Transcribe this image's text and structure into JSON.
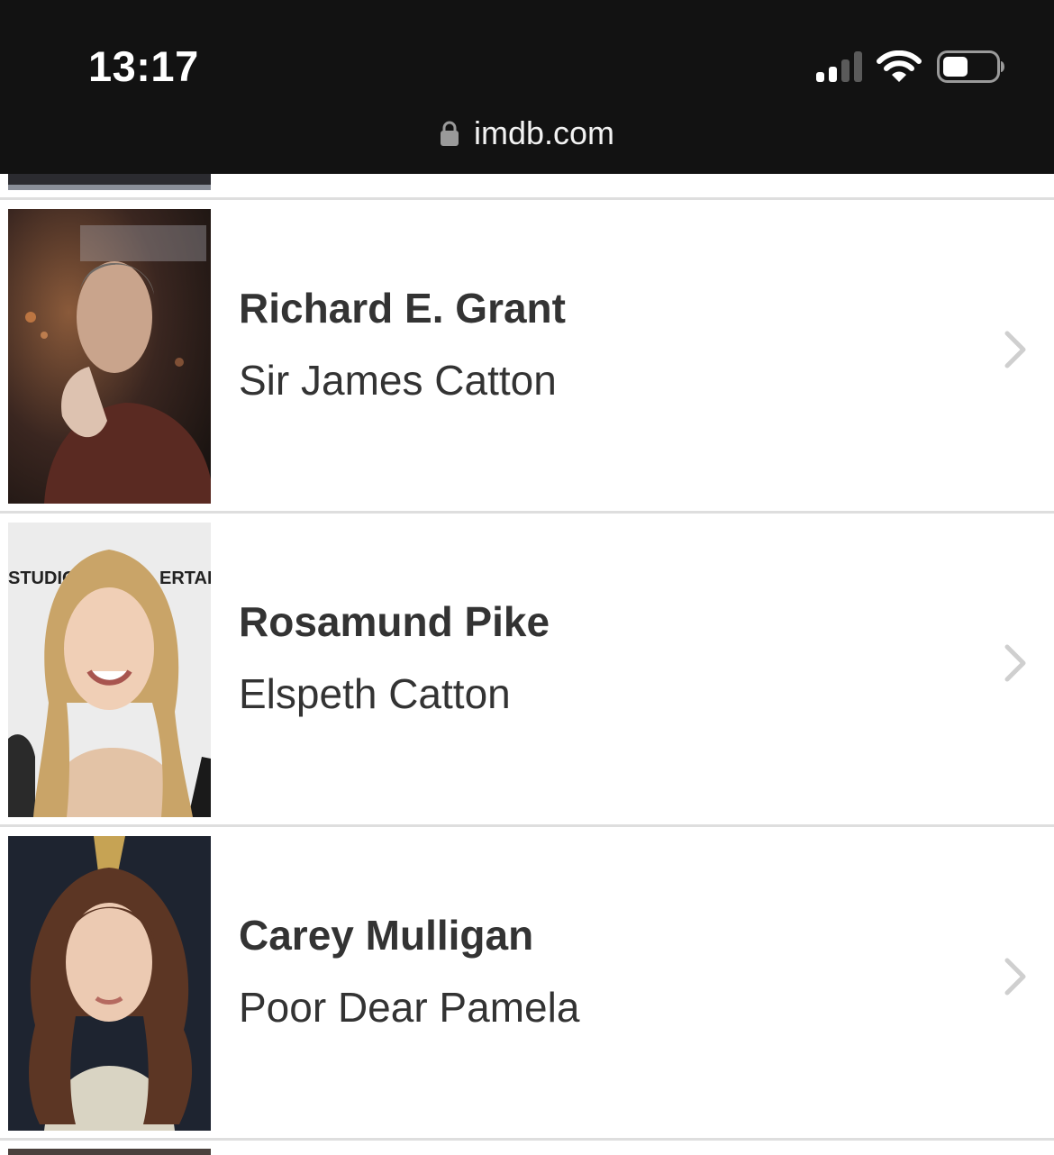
{
  "status_bar": {
    "time": "13:17",
    "signal_icon": "cellular-signal-icon",
    "wifi_icon": "wifi-icon",
    "battery_icon": "battery-icon"
  },
  "browser": {
    "url": "imdb.com",
    "lock_icon": "lock-icon"
  },
  "cast": [
    {
      "actor": "Richard E. Grant",
      "character": "Sir James Catton"
    },
    {
      "actor": "Rosamund Pike",
      "character": "Elspeth Catton"
    },
    {
      "actor": "Carey Mulligan",
      "character": "Poor Dear Pamela"
    }
  ],
  "photo_text": {
    "backdrop_left": "STUDIOS",
    "backdrop_right": "ERTAINM"
  },
  "colors": {
    "top_bar": "#121212",
    "text": "#333333",
    "divider": "#dedede",
    "chevron": "#cfcfcf"
  }
}
